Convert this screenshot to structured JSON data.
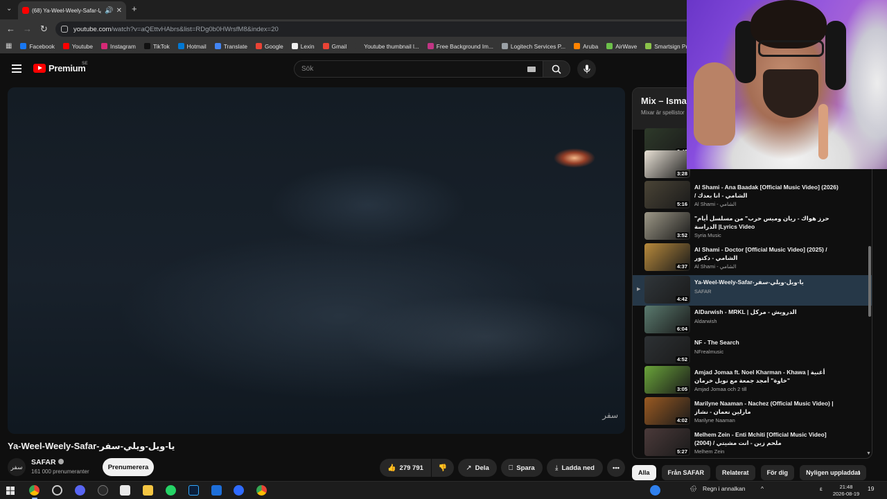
{
  "browser": {
    "tab": {
      "title": "(68) Ya-Weel-Weely-Safar-يا",
      "favicon": "youtube-icon"
    },
    "address": {
      "host": "youtube.com",
      "path": "/watch?v=aQEttvHAbrs&list=RDg0b0HWrsfM8&index=20"
    },
    "bookmarks": [
      {
        "label": "Facebook",
        "color": "#1877f2"
      },
      {
        "label": "Youtube",
        "color": "#ff0000"
      },
      {
        "label": "Instagram",
        "color": "#d62976"
      },
      {
        "label": "TikTok",
        "color": "#111111"
      },
      {
        "label": "Hotmail",
        "color": "#0078d4"
      },
      {
        "label": "Translate",
        "color": "#4285f4"
      },
      {
        "label": "Google",
        "color": "#ea4335"
      },
      {
        "label": "Lexin",
        "color": "#f0f0f0"
      },
      {
        "label": "Gmail",
        "color": "#ea4335"
      },
      {
        "label": "Youtube thumbnail l...",
        "color": "#353535"
      },
      {
        "label": "Free Background Im...",
        "color": "#c13584"
      },
      {
        "label": "Logitech Services P...",
        "color": "#9aa0a6"
      },
      {
        "label": "Aruba",
        "color": "#ff8300"
      },
      {
        "label": "AirWave",
        "color": "#6cc04a"
      },
      {
        "label": "Smartsign Publ",
        "color": "#8bc34a"
      }
    ]
  },
  "youtube": {
    "brand": "Premium",
    "region": "SE",
    "search_placeholder": "Sök",
    "video": {
      "title": "Ya-Weel-Weely-Safar-يا-ويل-ويلي-سفر",
      "watermark": "سفر",
      "channel": "SAFAR",
      "subscribers": "161 000 prenumeranter",
      "subscribe_label": "Prenumerera",
      "likes": "279 791",
      "share_label": "Dela",
      "save_label": "Spara",
      "download_label": "Ladda ned",
      "more_label": "•••"
    },
    "playlist": {
      "title": "Mix – Isma",
      "subtitle": "Mixar är spellistor",
      "items": [
        {
          "title": "",
          "channel": "",
          "duration": "3:42",
          "thumb": "#2e3a2a"
        },
        {
          "title": "",
          "channel": "",
          "duration": "3:28",
          "thumb": "#e9e2d6"
        },
        {
          "title": "Al Shami - Ana Baadak [Official Music Video] (2026) / الشامي - انا بعدك",
          "channel": "Al Shami - الشامي",
          "duration": "5:16",
          "thumb": "#4a4436"
        },
        {
          "title": "\"حرز هواك - ريان وميس حرب\" من مسلسل أيام الدراسة |Lyrics Video",
          "channel": "Syria Music",
          "duration": "3:52",
          "thumb": "#9d9887"
        },
        {
          "title": "Al Shami - Doctor [Official Music Video] (2025) / الشامي - دكتور",
          "channel": "Al Shami - الشامي",
          "duration": "4:37",
          "thumb": "#b88a3c"
        },
        {
          "title": "Ya-Weel-Weely-Safar-يا-ويل-ويلي-سفر",
          "channel": "SAFAR",
          "duration": "4:42",
          "thumb": "#30363a",
          "active": true
        },
        {
          "title": "AlDarwish - MRKL | الدرويش - مركل",
          "channel": "Aldarwish",
          "duration": "6:04",
          "thumb": "#5a7a6e"
        },
        {
          "title": "NF - The Search",
          "channel": "NFrealmusic",
          "duration": "4:52",
          "thumb": "#2d3134"
        },
        {
          "title": "Amjad Jomaa ft. Noel Kharman - Khawa | أغنية \"خاوة\" أمجد جمعة مع نويل خرمان",
          "channel": "Amjad Jomaa och 2 till",
          "duration": "3:05",
          "thumb": "#6aa43a"
        },
        {
          "title": "Marilyne Naaman - Nachez (Official Music Video) | مارلين نعمان - نشاز",
          "channel": "Marilyne Naaman",
          "duration": "4:02",
          "thumb": "#9a5a22"
        },
        {
          "title": "Melhem Zein - Enti Mchiti [Official Music Video] (2004) / ملحم زين - انت مشيتي",
          "channel": "Melhem Zein",
          "duration": "5:27",
          "thumb": "#4b3a3a"
        }
      ]
    },
    "chips": [
      "Alla",
      "Från SAFAR",
      "Relaterat",
      "För dig",
      "Nyligen uppladdat"
    ]
  },
  "taskbar": {
    "weather": "Regn i annalkan",
    "lang": "ε",
    "time": "21:48",
    "date": "2026-08-19",
    "notifications": "19"
  }
}
